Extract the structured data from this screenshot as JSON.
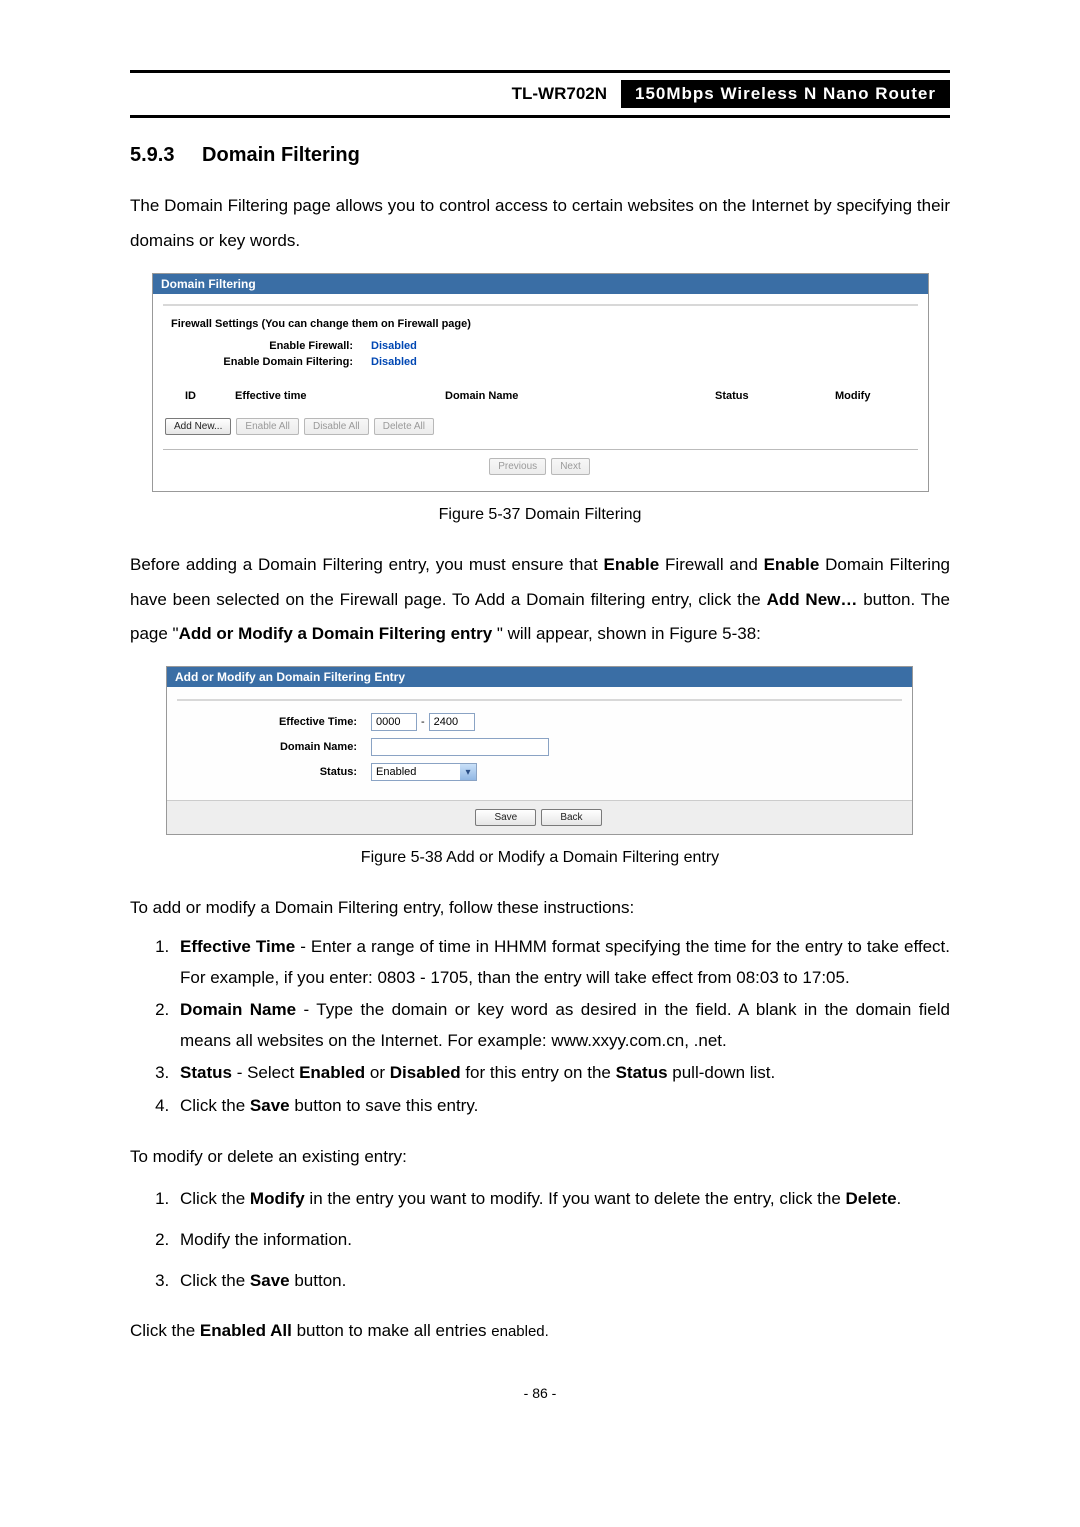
{
  "header": {
    "model": "TL-WR702N",
    "desc": "150Mbps Wireless N Nano Router"
  },
  "section": {
    "number": "5.9.3",
    "title": "Domain Filtering"
  },
  "intro_text": "The Domain Filtering page allows you to control access to certain websites on the Internet by specifying their domains or key words.",
  "fig1": {
    "title": "Domain Filtering",
    "subhead": "Firewall Settings (You can change them on Firewall page)",
    "rows": {
      "enable_firewall_label": "Enable Firewall:",
      "enable_firewall_value": "Disabled",
      "enable_domain_label": "Enable Domain Filtering:",
      "enable_domain_value": "Disabled"
    },
    "thead": {
      "id": "ID",
      "time": "Effective time",
      "domain": "Domain Name",
      "status": "Status",
      "modify": "Modify"
    },
    "buttons": {
      "add_new": "Add New...",
      "enable_all": "Enable All",
      "disable_all": "Disable All",
      "delete_all": "Delete All",
      "previous": "Previous",
      "next": "Next"
    }
  },
  "caption1": "Figure 5-37 Domain Filtering",
  "paragraph2_pre": "Before adding a Domain Filtering entry, you must ensure that ",
  "paragraph2_b1": "Enable",
  "paragraph2_mid1": " Firewall and ",
  "paragraph2_b2": "Enable",
  "paragraph2_mid2": " Domain Filtering have been selected on the Firewall page. To Add a Domain filtering entry, click the ",
  "paragraph2_b3": "Add New…",
  "paragraph2_mid3": " button. The page \"",
  "paragraph2_b4": "Add or Modify a Domain Filtering entry ",
  "paragraph2_end": "\" will appear, shown in Figure 5-38:",
  "fig2": {
    "title": "Add or Modify an Domain Filtering Entry",
    "labels": {
      "effective_time": "Effective Time:",
      "domain_name": "Domain Name:",
      "status": "Status:"
    },
    "values": {
      "time_from": "0000",
      "time_to": "2400",
      "status_value": "Enabled"
    },
    "buttons": {
      "save": "Save",
      "back": "Back"
    }
  },
  "caption2": "Figure 5-38 Add or Modify a Domain Filtering entry",
  "instr_intro": "To add or modify a Domain Filtering entry, follow these instructions:",
  "instr_list": {
    "i1_b": "Effective Time",
    "i1_rest": " - Enter a range of time in HHMM format specifying the time for the entry to take effect. For example, if you enter: 0803 - 1705, than the entry will take effect from 08:03 to 17:05.",
    "i2_b": "Domain Name",
    "i2_rest": " - Type the domain or key word as desired in the field. A blank in the domain field means all websites on the Internet. For example: www.xxyy.com.cn, .net.",
    "i3_b1": "Status",
    "i3_mid1": " - Select ",
    "i3_b2": "Enabled",
    "i3_mid2": " or ",
    "i3_b3": "Disabled",
    "i3_mid3": " for this entry on the ",
    "i3_b4": "Status",
    "i3_end": " pull-down list.",
    "i4_pre": "Click the ",
    "i4_b": "Save",
    "i4_end": " button to save this entry."
  },
  "modify_intro": "To modify or delete an existing entry:",
  "modify_list": {
    "m1_pre": "Click the ",
    "m1_b1": "Modify",
    "m1_mid": " in the entry you want to modify. If you want to delete the entry, click the ",
    "m1_b2": "Delete",
    "m1_end": ".",
    "m2": "Modify the information.",
    "m3_pre": "Click the ",
    "m3_b": "Save",
    "m3_end": " button."
  },
  "footer_line_pre": "Click the ",
  "footer_line_b": "Enabled All",
  "footer_line_mid": " button to make all entries ",
  "footer_line_small": "enabled.",
  "page_number": "- 86 -"
}
